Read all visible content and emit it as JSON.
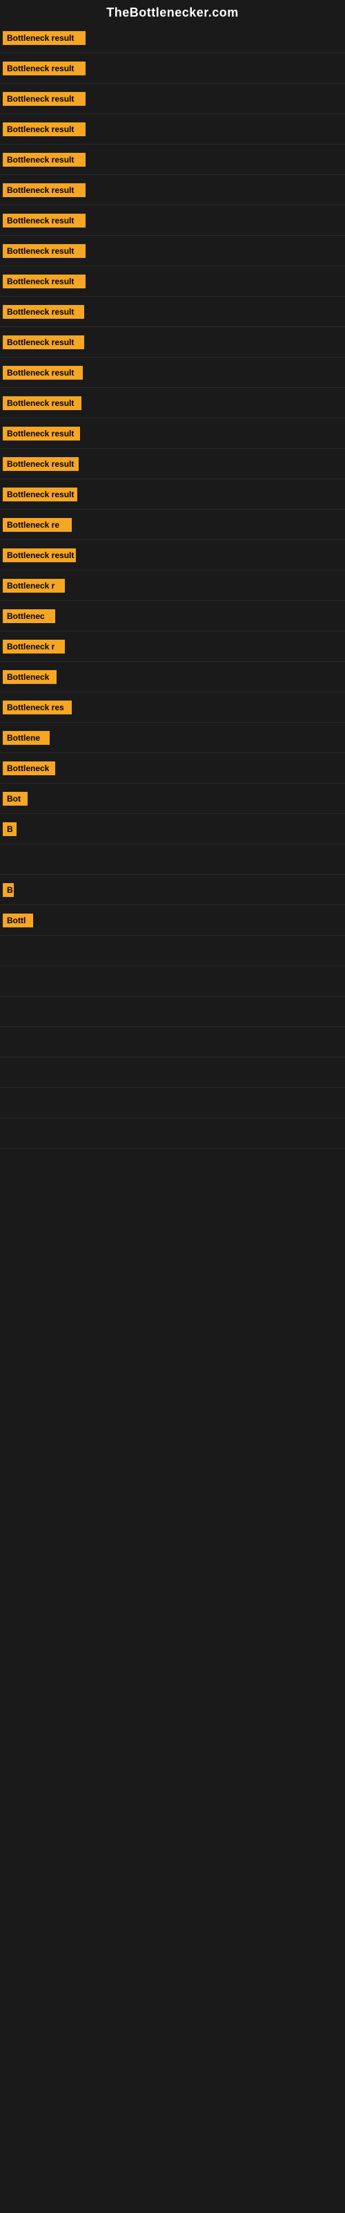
{
  "site": {
    "title": "TheBottlenecker.com"
  },
  "rows": [
    {
      "id": 1,
      "label": "Bottleneck result",
      "width": 120,
      "visible": true
    },
    {
      "id": 2,
      "label": "Bottleneck result",
      "width": 120,
      "visible": true
    },
    {
      "id": 3,
      "label": "Bottleneck result",
      "width": 120,
      "visible": true
    },
    {
      "id": 4,
      "label": "Bottleneck result",
      "width": 120,
      "visible": true
    },
    {
      "id": 5,
      "label": "Bottleneck result",
      "width": 120,
      "visible": true
    },
    {
      "id": 6,
      "label": "Bottleneck result",
      "width": 120,
      "visible": true
    },
    {
      "id": 7,
      "label": "Bottleneck result",
      "width": 120,
      "visible": true
    },
    {
      "id": 8,
      "label": "Bottleneck result",
      "width": 120,
      "visible": true
    },
    {
      "id": 9,
      "label": "Bottleneck result",
      "width": 120,
      "visible": true
    },
    {
      "id": 10,
      "label": "Bottleneck result",
      "width": 118,
      "visible": true
    },
    {
      "id": 11,
      "label": "Bottleneck result",
      "width": 118,
      "visible": true
    },
    {
      "id": 12,
      "label": "Bottleneck result",
      "width": 116,
      "visible": true
    },
    {
      "id": 13,
      "label": "Bottleneck result",
      "width": 114,
      "visible": true
    },
    {
      "id": 14,
      "label": "Bottleneck result",
      "width": 112,
      "visible": true
    },
    {
      "id": 15,
      "label": "Bottleneck result",
      "width": 110,
      "visible": true
    },
    {
      "id": 16,
      "label": "Bottleneck result",
      "width": 108,
      "visible": true
    },
    {
      "id": 17,
      "label": "Bottleneck re",
      "width": 100,
      "visible": true
    },
    {
      "id": 18,
      "label": "Bottleneck result",
      "width": 106,
      "visible": true
    },
    {
      "id": 19,
      "label": "Bottleneck r",
      "width": 90,
      "visible": true
    },
    {
      "id": 20,
      "label": "Bottlenec",
      "width": 76,
      "visible": true
    },
    {
      "id": 21,
      "label": "Bottleneck r",
      "width": 90,
      "visible": true
    },
    {
      "id": 22,
      "label": "Bottleneck",
      "width": 78,
      "visible": true
    },
    {
      "id": 23,
      "label": "Bottleneck res",
      "width": 100,
      "visible": true
    },
    {
      "id": 24,
      "label": "Bottlene",
      "width": 68,
      "visible": true
    },
    {
      "id": 25,
      "label": "Bottleneck",
      "width": 76,
      "visible": true
    },
    {
      "id": 26,
      "label": "Bot",
      "width": 36,
      "visible": true
    },
    {
      "id": 27,
      "label": "B",
      "width": 20,
      "visible": true
    },
    {
      "id": 28,
      "label": "",
      "width": 0,
      "visible": false
    },
    {
      "id": 29,
      "label": "B",
      "width": 16,
      "visible": true
    },
    {
      "id": 30,
      "label": "Bottl",
      "width": 44,
      "visible": true
    },
    {
      "id": 31,
      "label": "",
      "width": 0,
      "visible": false
    },
    {
      "id": 32,
      "label": "",
      "width": 0,
      "visible": false
    },
    {
      "id": 33,
      "label": "",
      "width": 0,
      "visible": false
    },
    {
      "id": 34,
      "label": "",
      "width": 0,
      "visible": false
    },
    {
      "id": 35,
      "label": "",
      "width": 0,
      "visible": false
    },
    {
      "id": 36,
      "label": "",
      "width": 0,
      "visible": false
    },
    {
      "id": 37,
      "label": "",
      "width": 0,
      "visible": false
    }
  ],
  "colors": {
    "background": "#1a1a1a",
    "bar_fill": "#f5a623",
    "bar_text": "#000000",
    "title_text": "#ffffff"
  }
}
